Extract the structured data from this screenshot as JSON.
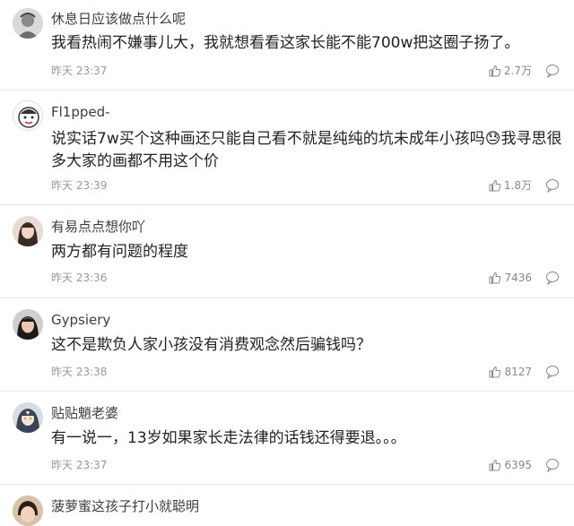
{
  "comments": [
    {
      "username": "休息日应该做点什么呢",
      "content": "我看热闹不嫌事儿大，我就想看看这家长能不能700w把这圈子扬了。",
      "time": "昨天 23:37",
      "likes": "2.7万",
      "avatar": "avatar-sketch-girl"
    },
    {
      "username": "Fl1pped-",
      "content": "说实话7w买个这种画还只能自己看不就是纯纯的坑未成年小孩吗😓我寻思很多大家的画都不用这个价",
      "time": "昨天 23:39",
      "likes": "1.8万",
      "avatar": "avatar-cartoon-face"
    },
    {
      "username": "有易点点想你吖",
      "content": "两方都有问题的程度",
      "time": "昨天 23:36",
      "likes": "7436",
      "avatar": "avatar-photo-girl"
    },
    {
      "username": "Gypsiery",
      "content": "这不是欺负人家小孩没有消费观念然后骗钱吗？",
      "time": "昨天 23:38",
      "likes": "8127",
      "avatar": "avatar-photo-portrait"
    },
    {
      "username": "贴贴魈老婆",
      "content": "有一说一，13岁如果家长走法律的话钱还得要退。。。",
      "time": "昨天 23:37",
      "likes": "6395",
      "avatar": "avatar-anime-character"
    },
    {
      "username": "菠萝蜜这孩子打小就聪明",
      "content": "",
      "time": "",
      "likes": "",
      "avatar": "avatar-photo-child"
    }
  ],
  "icons": {
    "like": "thumbs-up-icon",
    "reply": "comment-bubble-icon"
  },
  "colors": {
    "username": "#3d3d3d",
    "content": "#222222",
    "meta": "#999999",
    "divider": "#e8e8e8"
  }
}
